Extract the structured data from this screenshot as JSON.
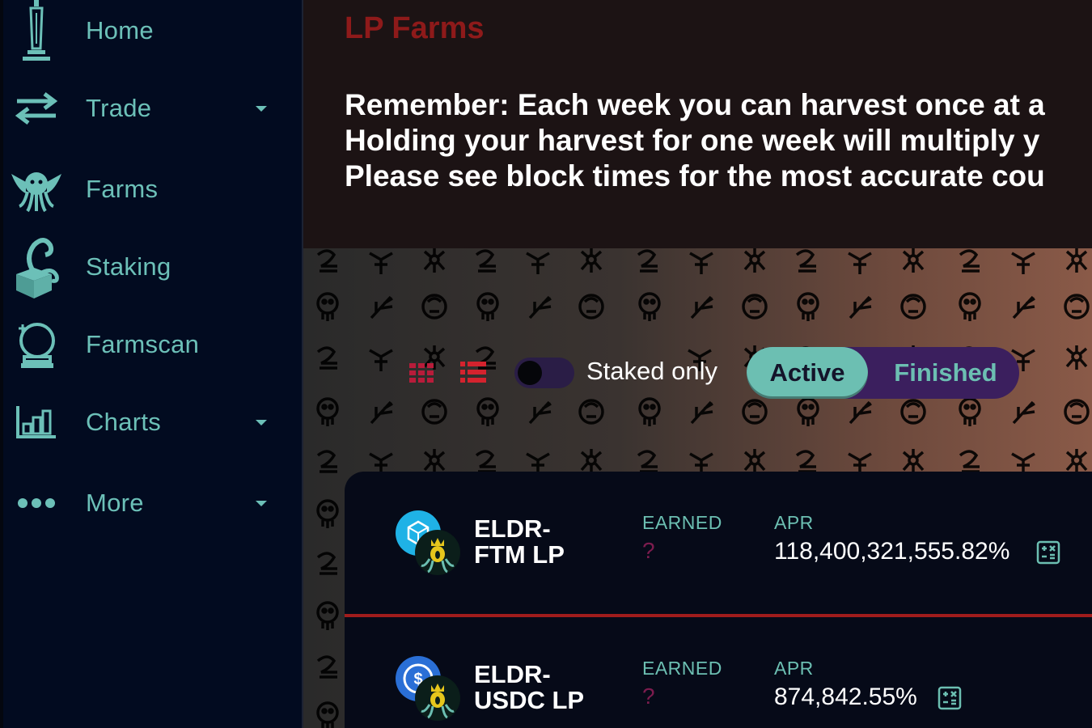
{
  "sidebar": {
    "items": [
      {
        "label": "Home",
        "icon": "obelisk-icon",
        "has_caret": false
      },
      {
        "label": "Trade",
        "icon": "swap-arrows-icon",
        "has_caret": true
      },
      {
        "label": "Farms",
        "icon": "cthulhu-icon",
        "has_caret": false
      },
      {
        "label": "Staking",
        "icon": "tentacle-icon",
        "has_caret": false
      },
      {
        "label": "Farmscan",
        "icon": "crystal-ball-icon",
        "has_caret": false
      },
      {
        "label": "Charts",
        "icon": "bar-chart-icon",
        "has_caret": true
      },
      {
        "label": "More",
        "icon": "ellipsis-icon",
        "has_caret": true
      }
    ],
    "accent_color": "#6cc0b8"
  },
  "header": {
    "title": "LP Farms",
    "notice_lines": [
      "Remember: Each week you can harvest once at a",
      "Holding your harvest for one week will multiply y",
      "Please see block times for the most accurate cou"
    ]
  },
  "controls": {
    "staked_only_label": "Staked only",
    "staked_only_on": false,
    "tabs": [
      "Active",
      "Finished"
    ],
    "selected_tab": "Active"
  },
  "farms": [
    {
      "name_line1": "ELDR-",
      "name_line2": "FTM LP",
      "earned_label": "EARNED",
      "earned_value": "?",
      "apr_label": "APR",
      "apr_value": "118,400,321,555.82%",
      "quote_token_icon": "fantom-icon"
    },
    {
      "name_line1": "ELDR-",
      "name_line2": "USDC LP",
      "earned_label": "EARNED",
      "earned_value": "?",
      "apr_label": "APR",
      "apr_value": "874,842.55%",
      "quote_token_icon": "usdc-icon"
    }
  ],
  "colors": {
    "title_red": "#8e1a1a",
    "teal": "#6cbfb2",
    "purple": "#3b1f5e",
    "divider_red": "#a01c1c"
  }
}
